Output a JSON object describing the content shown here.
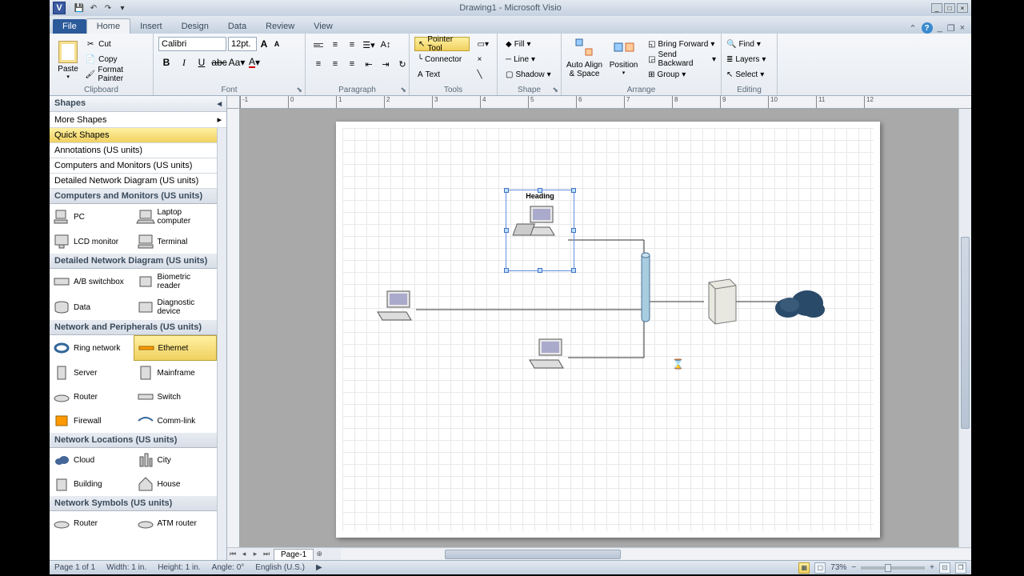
{
  "titlebar": {
    "title": "Drawing1 - Microsoft Visio"
  },
  "tabs": {
    "file": "File",
    "home": "Home",
    "insert": "Insert",
    "design": "Design",
    "data": "Data",
    "review": "Review",
    "view": "View"
  },
  "ribbon": {
    "clipboard": {
      "label": "Clipboard",
      "paste": "Paste",
      "cut": "Cut",
      "copy": "Copy",
      "format_painter": "Format Painter"
    },
    "font": {
      "label": "Font",
      "name": "Calibri",
      "size": "12pt."
    },
    "paragraph": {
      "label": "Paragraph"
    },
    "tools": {
      "label": "Tools",
      "pointer": "Pointer Tool",
      "connector": "Connector",
      "text": "Text"
    },
    "shape": {
      "label": "Shape",
      "fill": "Fill",
      "line": "Line",
      "shadow": "Shadow"
    },
    "arrange": {
      "label": "Arrange",
      "autoalign": "Auto Align & Space",
      "position": "Position",
      "bring_forward": "Bring Forward",
      "send_backward": "Send Backward",
      "group": "Group"
    },
    "editing": {
      "label": "Editing",
      "find": "Find",
      "layers": "Layers",
      "select": "Select"
    }
  },
  "shapes_panel": {
    "header": "Shapes",
    "more_shapes": "More Shapes",
    "categories": [
      "Quick Shapes",
      "Annotations (US units)",
      "Computers and Monitors (US units)",
      "Detailed Network Diagram (US units)"
    ],
    "sections": {
      "computers": {
        "title": "Computers and Monitors (US units)",
        "items": [
          "PC",
          "Laptop computer",
          "LCD monitor",
          "Terminal"
        ]
      },
      "detailed": {
        "title": "Detailed Network Diagram (US units)",
        "items": [
          "A/B switchbox",
          "Biometric reader",
          "Data",
          "Diagnostic device"
        ]
      },
      "network": {
        "title": "Network and Peripherals (US units)",
        "items": [
          "Ring network",
          "Ethernet",
          "Server",
          "Mainframe",
          "Router",
          "Switch",
          "Firewall",
          "Comm-link"
        ]
      },
      "locations": {
        "title": "Network Locations (US units)",
        "items": [
          "Cloud",
          "City",
          "Building",
          "House"
        ]
      },
      "symbols": {
        "title": "Network Symbols (US units)",
        "items": [
          "Router",
          "ATM router"
        ]
      }
    }
  },
  "canvas": {
    "selected_label": "Heading"
  },
  "page_tabs": {
    "page1": "Page-1"
  },
  "statusbar": {
    "page": "Page 1 of 1",
    "width": "Width: 1 in.",
    "height": "Height: 1 in.",
    "angle": "Angle: 0°",
    "language": "English (U.S.)",
    "zoom": "73%"
  }
}
